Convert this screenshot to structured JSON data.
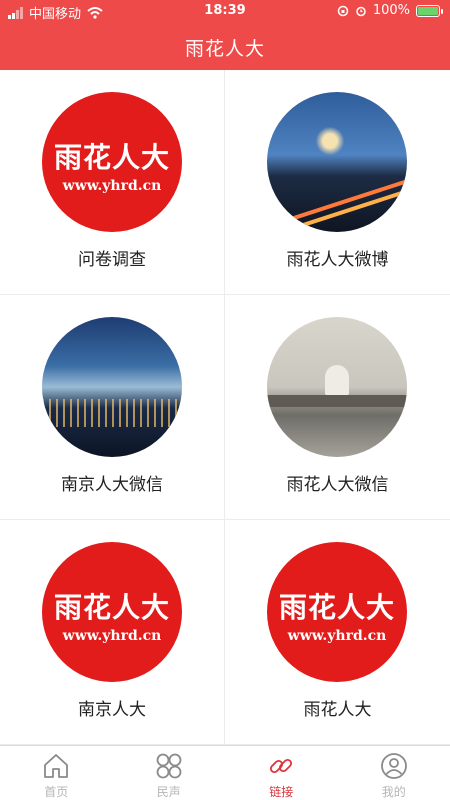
{
  "status": {
    "carrier": "中国移动",
    "time": "18:39",
    "battery": "100%"
  },
  "header": {
    "title": "雨花人大"
  },
  "links": [
    {
      "label": "问卷调查",
      "image": "yhrd-logo"
    },
    {
      "label": "雨花人大微博",
      "image": "night-city-photo"
    },
    {
      "label": "南京人大微信",
      "image": "nanjing-skyline-photo"
    },
    {
      "label": "雨花人大微信",
      "image": "capitol-bridge-photo"
    },
    {
      "label": "南京人大",
      "image": "yhrd-logo"
    },
    {
      "label": "雨花人大",
      "image": "yhrd-logo"
    }
  ],
  "logo": {
    "text": "雨花人大",
    "url": "www.yhrd.cn"
  },
  "tabs": [
    {
      "label": "首页",
      "icon": "home-icon"
    },
    {
      "label": "民声",
      "icon": "grid-icon"
    },
    {
      "label": "链接",
      "icon": "link-icon",
      "active": true
    },
    {
      "label": "我的",
      "icon": "user-icon"
    }
  ],
  "colors": {
    "brand": "#ee4a4a",
    "logo_red": "#e21b1b",
    "active_tab": "#d9363e"
  }
}
